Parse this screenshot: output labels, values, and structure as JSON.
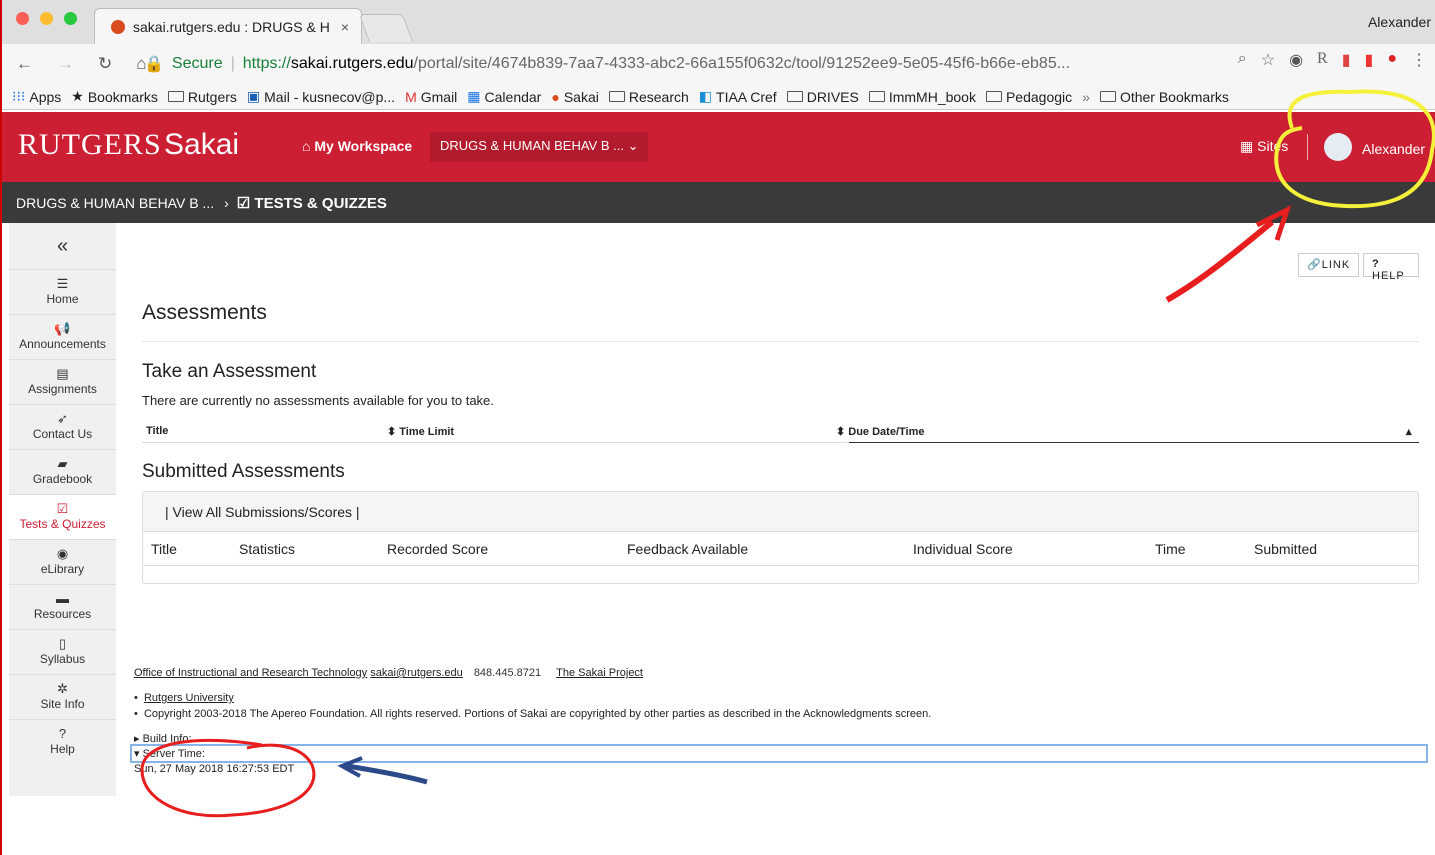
{
  "browser": {
    "tab_title": "sakai.rutgers.edu : DRUGS & H",
    "tab_close": "×",
    "profile_name": "Alexander",
    "url_secure": "Secure",
    "url_proto": "https://",
    "url_host": "sakai.rutgers.edu",
    "url_path": "/portal/site/4674b839-7aa7-4333-abc2-66a155f0632c/tool/91252ee9-5e05-45f6-b66e-eb85...",
    "bookmarks": [
      "Apps",
      "Bookmarks",
      "Rutgers",
      "Mail - kusnecov@p...",
      "Gmail",
      "Calendar",
      "Sakai",
      "Research",
      "TIAA Cref",
      "DRIVES",
      "ImmMH_book",
      "Pedagogic",
      "»",
      "Other Bookmarks"
    ]
  },
  "header": {
    "logo": "RUTGERS",
    "product": "Sakai",
    "workspace": "My Workspace",
    "site": "DRUGS & HUMAN BEHAV B ... ⌄",
    "sites": "Sites",
    "user": "Alexander"
  },
  "breadcrumb": {
    "site": "DRUGS & HUMAN BEHAV B ...",
    "arrow": "›",
    "tool": "TESTS & QUIZZES"
  },
  "sidebar": {
    "collapse": "«",
    "items": [
      {
        "label": "Home",
        "icon": "☰"
      },
      {
        "label": "Announcements",
        "icon": "📢"
      },
      {
        "label": "Assignments",
        "icon": "▤"
      },
      {
        "label": "Contact Us",
        "icon": "➶"
      },
      {
        "label": "Gradebook",
        "icon": "▰"
      },
      {
        "label": "Tests & Quizzes",
        "icon": "☑"
      },
      {
        "label": "eLibrary",
        "icon": "◉"
      },
      {
        "label": "Resources",
        "icon": "▬"
      },
      {
        "label": "Syllabus",
        "icon": "▯"
      },
      {
        "label": "Site Info",
        "icon": "✲"
      },
      {
        "label": "Help",
        "icon": "?"
      }
    ]
  },
  "main": {
    "link": "LINK",
    "help": "HELP",
    "title": "Assessments",
    "take_title": "Take an Assessment",
    "no_assess": "There are currently no assessments available for you to take.",
    "take_cols": {
      "title": "Title",
      "time_limit": "⬍ Time Limit",
      "due": "⬍ Due Date/Time",
      "sort": "▴"
    },
    "submitted_title": "Submitted Assessments",
    "view_all": "|  View All Submissions/Scores  |",
    "sub_cols": [
      "Title",
      "Statistics",
      "Recorded Score",
      "Feedback Available",
      "Individual Score",
      "Time",
      "Submitted"
    ]
  },
  "footer": {
    "oirt": "Office of Instructional and Research Technology",
    "email": "sakai@rutgers.edu",
    "phone": "848.445.8721",
    "project": "The Sakai Project",
    "ru": "Rutgers University",
    "copyright": "Copyright 2003-2018 The Apereo Foundation. All rights reserved. Portions of Sakai are copyrighted by other parties as described in the Acknowledgments screen.",
    "build": "▸ Build Info:",
    "server": "▾ Server Time:",
    "server_time": "Sun, 27 May 2018 16:27:53 EDT"
  },
  "colors": {
    "brand": "#cc1f34",
    "crumb_bg": "#3a3a3a"
  }
}
